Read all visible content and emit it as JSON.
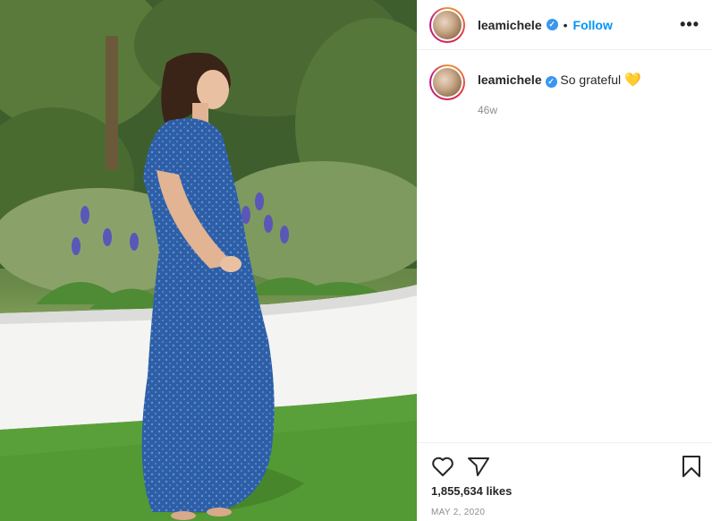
{
  "post": {
    "photo_label": "Post photo",
    "header": {
      "username": "leamichele",
      "verified_glyph": "✓",
      "separator": "•",
      "follow_label": "Follow",
      "more_glyph": "•••"
    },
    "caption": {
      "username": "leamichele",
      "text": "So grateful",
      "emoji": "💛",
      "time": "46w"
    },
    "actions": {
      "icons": [
        "heart-outline-icon",
        "send-icon",
        "bookmark-icon"
      ],
      "likes": "1,855,634 likes",
      "date": "MAY 2, 2020"
    }
  },
  "colors": {
    "follow": "#0095f6",
    "verified": "#3897f0",
    "meta_text": "#8e8e8e",
    "heart_emoji": "#f5d90a"
  }
}
